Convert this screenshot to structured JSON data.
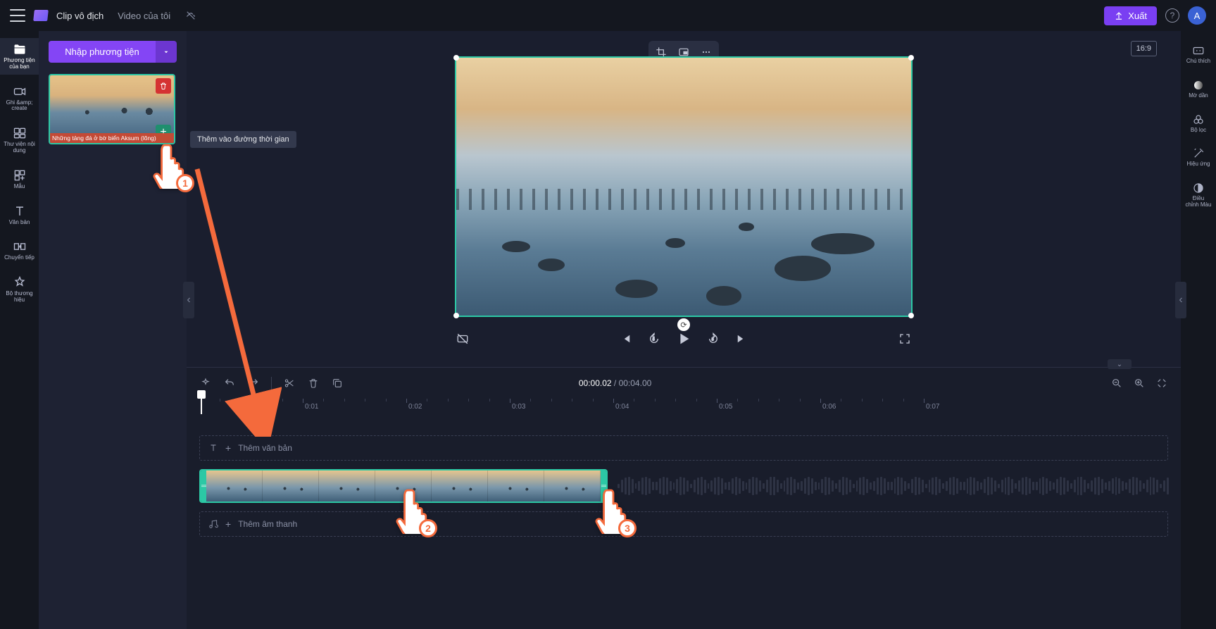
{
  "topbar": {
    "app_title": "Clip vô địch",
    "my_video_tab": "Video của tôi",
    "export_label": "Xuất",
    "avatar_letter": "A"
  },
  "leftnav": {
    "your_media": "Phương tiện của bạn",
    "record_create": "Ghi &amp;\ncreate",
    "content_library": "Thư viện nội\ndung",
    "templates": "Mẫu",
    "text": "Văn bản",
    "transitions": "Chuyển tiếp",
    "brand_kit": "Bộ thương hiệu"
  },
  "panel": {
    "import_label": "Nhập phương tiện",
    "thumb_caption": "Những tảng đá ở bờ biển Aksum (lõng)",
    "tooltip": "Thêm vào đường thời gian"
  },
  "preview": {
    "ratio": "16:9"
  },
  "rightnav": {
    "captions": "Chú thích",
    "fade": "Mờ dần",
    "filters": "Bộ lọc",
    "effects": "Hiệu ứng",
    "adjust_color": "Điều\nchỉnh Màu"
  },
  "timeline": {
    "current": "00:00.02",
    "total": "00:04.00",
    "ticks": [
      "0:01",
      "0:02",
      "0:03",
      "0:04",
      "0:05",
      "0:06",
      "0:07"
    ],
    "add_text": "Thêm văn bản",
    "add_audio": "Thêm âm thanh"
  },
  "annotations": {
    "num1": "1",
    "num2": "2",
    "num3": "3"
  }
}
